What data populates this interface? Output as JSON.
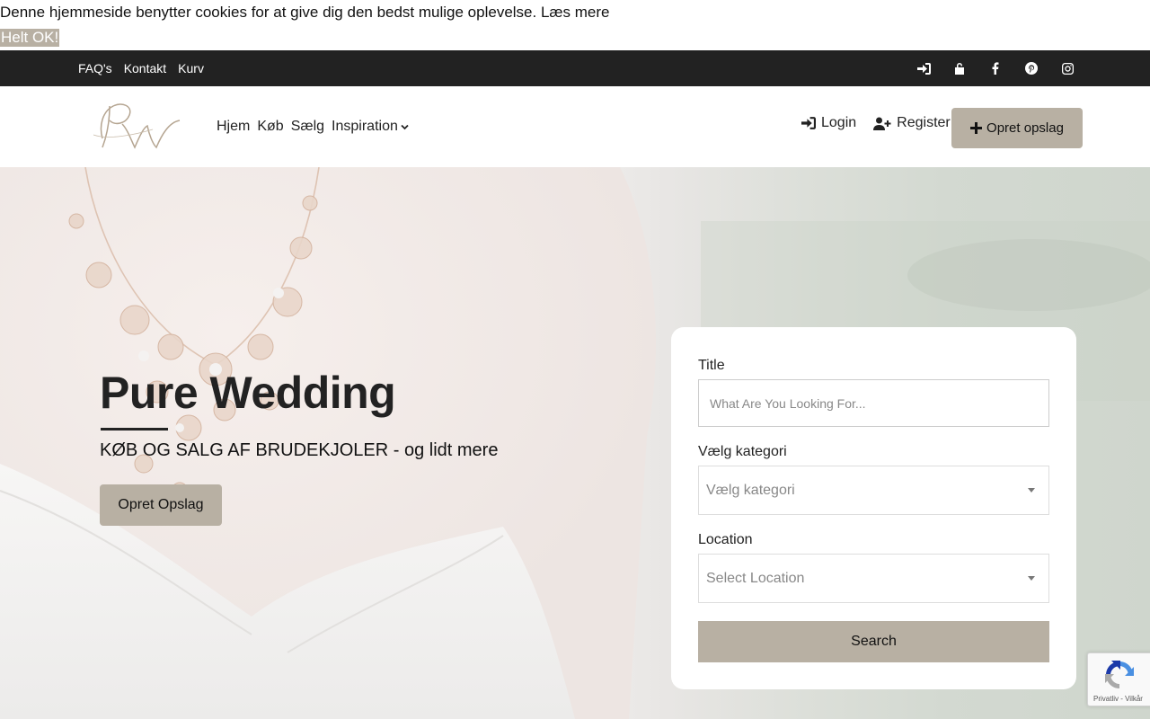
{
  "cookie": {
    "message": "Denne hjemmeside benytter cookies for at give dig den bedst mulige oplevelse.",
    "read_more": "Læs mere",
    "accept": "Helt OK!"
  },
  "topbar": {
    "links": [
      "FAQ's",
      "Kontakt",
      "Kurv"
    ],
    "icons": [
      "sign-in-icon",
      "unlock-icon",
      "facebook-icon",
      "pinterest-icon",
      "instagram-icon"
    ]
  },
  "nav": {
    "logo": "PW",
    "menu": [
      "Hjem",
      "Køb",
      "Sælg",
      "Inspiration"
    ],
    "login": "Login",
    "register": "Register",
    "create": "Opret opslag"
  },
  "hero": {
    "title": "Pure Wedding",
    "subtitle": "KØB OG SALG AF BRUDEKJOLER - og lidt mere",
    "button": "Opret Opslag"
  },
  "search": {
    "title_label": "Title",
    "title_placeholder": "What Are You Looking For...",
    "category_label": "Vælg kategori",
    "category_value": "Vælg kategori",
    "location_label": "Location",
    "location_value": "Select Location",
    "button": "Search"
  },
  "recaptcha": {
    "text": "Privatliv - Vilkår"
  },
  "colors": {
    "accent": "#b8b0a3",
    "topbar": "#222222"
  }
}
